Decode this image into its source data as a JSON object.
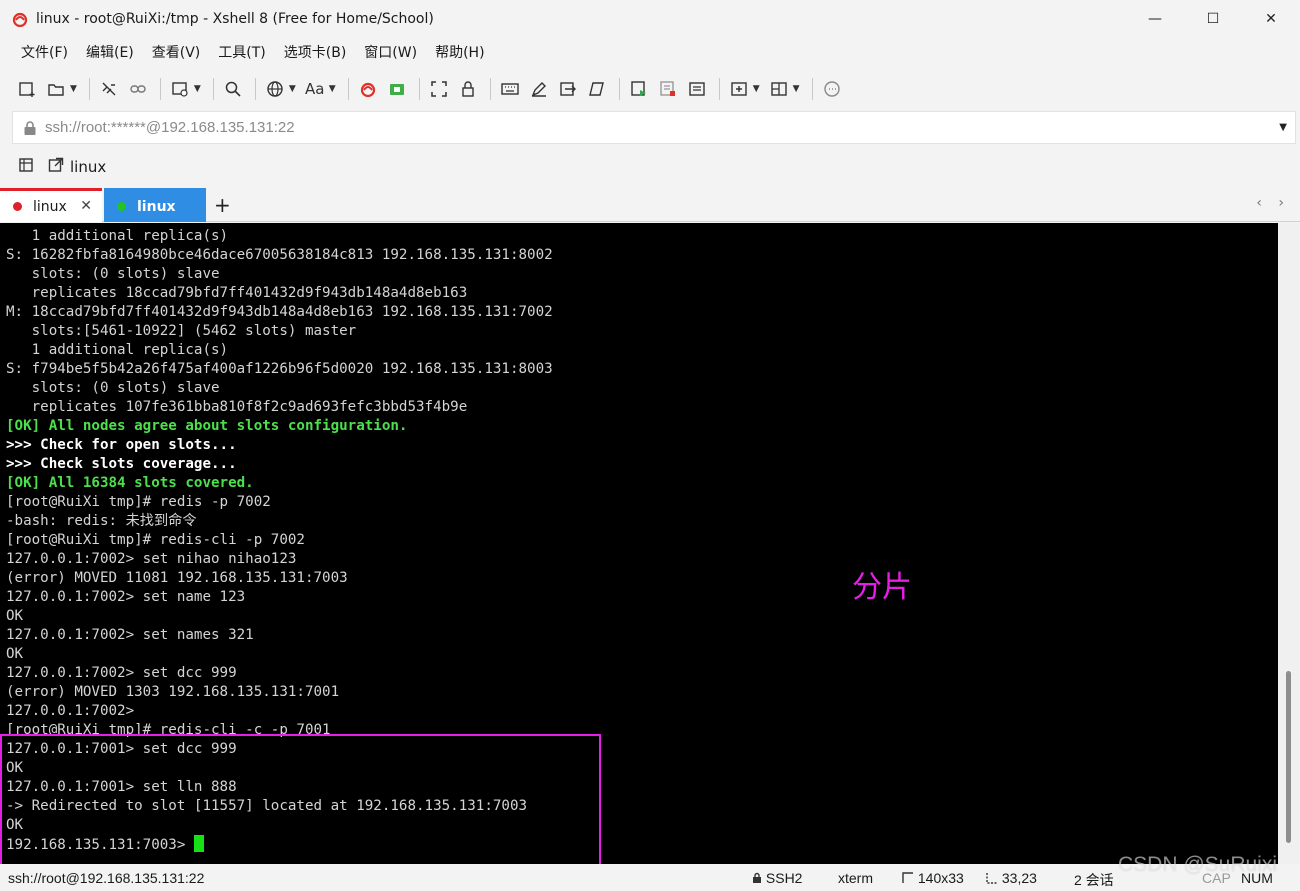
{
  "window": {
    "title": "linux - root@RuiXi:/tmp - Xshell 8 (Free for Home/School)",
    "minimize": "—",
    "maximize": "☐",
    "close": "✕"
  },
  "menu": [
    "文件(F)",
    "编辑(E)",
    "查看(V)",
    "工具(T)",
    "选项卡(B)",
    "窗口(W)",
    "帮助(H)"
  ],
  "toolbar": {
    "font_label": "Aa"
  },
  "address": {
    "value": "ssh://root:******@192.168.135.131:22"
  },
  "session": {
    "link_label": "linux"
  },
  "tabs": [
    {
      "label": "linux",
      "dot_color": "#e0202a",
      "close": "✕"
    },
    {
      "label": "linux",
      "dot_color": "#22c422"
    }
  ],
  "tab_add": "+",
  "tab_nav": "‹ ›",
  "terminal": {
    "lines": [
      {
        "text": "   1 additional replica(s)",
        "style": "normal"
      },
      {
        "text": "S: 16282fbfa8164980bce46dace67005638184c813 192.168.135.131:8002",
        "style": "normal"
      },
      {
        "text": "   slots: (0 slots) slave",
        "style": "normal"
      },
      {
        "text": "   replicates 18ccad79bfd7ff401432d9f943db148a4d8eb163",
        "style": "normal"
      },
      {
        "text": "M: 18ccad79bfd7ff401432d9f943db148a4d8eb163 192.168.135.131:7002",
        "style": "normal"
      },
      {
        "text": "   slots:[5461-10922] (5462 slots) master",
        "style": "normal"
      },
      {
        "text": "   1 additional replica(s)",
        "style": "normal"
      },
      {
        "text": "S: f794be5f5b42a26f475af400af1226b96f5d0020 192.168.135.131:8003",
        "style": "normal"
      },
      {
        "text": "   slots: (0 slots) slave",
        "style": "normal"
      },
      {
        "text": "   replicates 107fe361bba810f8f2c9ad693fefc3bbd53f4b9e",
        "style": "normal"
      },
      {
        "text": "[OK] All nodes agree about slots configuration.",
        "style": "ok"
      },
      {
        "text": ">>> Check for open slots...",
        "style": "bold"
      },
      {
        "text": ">>> Check slots coverage...",
        "style": "bold"
      },
      {
        "text": "[OK] All 16384 slots covered.",
        "style": "ok"
      },
      {
        "text": "[root@RuiXi tmp]# redis -p 7002",
        "style": "normal"
      },
      {
        "text": "-bash: redis: 未找到命令",
        "style": "normal"
      },
      {
        "text": "[root@RuiXi tmp]# redis-cli -p 7002",
        "style": "normal"
      },
      {
        "text": "127.0.0.1:7002> set nihao nihao123",
        "style": "normal"
      },
      {
        "text": "(error) MOVED 11081 192.168.135.131:7003",
        "style": "normal"
      },
      {
        "text": "127.0.0.1:7002> set name 123",
        "style": "normal"
      },
      {
        "text": "OK",
        "style": "normal"
      },
      {
        "text": "127.0.0.1:7002> set names 321",
        "style": "normal"
      },
      {
        "text": "OK",
        "style": "normal"
      },
      {
        "text": "127.0.0.1:7002> set dcc 999",
        "style": "normal"
      },
      {
        "text": "(error) MOVED 1303 192.168.135.131:7001",
        "style": "normal"
      },
      {
        "text": "127.0.0.1:7002>",
        "style": "normal"
      },
      {
        "text": "[root@RuiXi tmp]# redis-cli -c -p 7001",
        "style": "normal"
      },
      {
        "text": "127.0.0.1:7001> set dcc 999",
        "style": "normal"
      },
      {
        "text": "OK",
        "style": "normal"
      },
      {
        "text": "127.0.0.1:7001> set lln 888",
        "style": "normal"
      },
      {
        "text": "-> Redirected to slot [11557] located at 192.168.135.131:7003",
        "style": "normal"
      },
      {
        "text": "OK",
        "style": "normal"
      }
    ],
    "prompt": "192.168.135.131:7003> ",
    "annotation": "分片"
  },
  "status": {
    "connection": "ssh://root@192.168.135.131:22",
    "protocol": "SSH2",
    "term_type": "xterm",
    "size": "140x33",
    "cursor_pos": "33,23",
    "sessions": "2 会话",
    "caps": "CAP",
    "num": "NUM"
  },
  "watermark": "CSDN @SuRuixi"
}
